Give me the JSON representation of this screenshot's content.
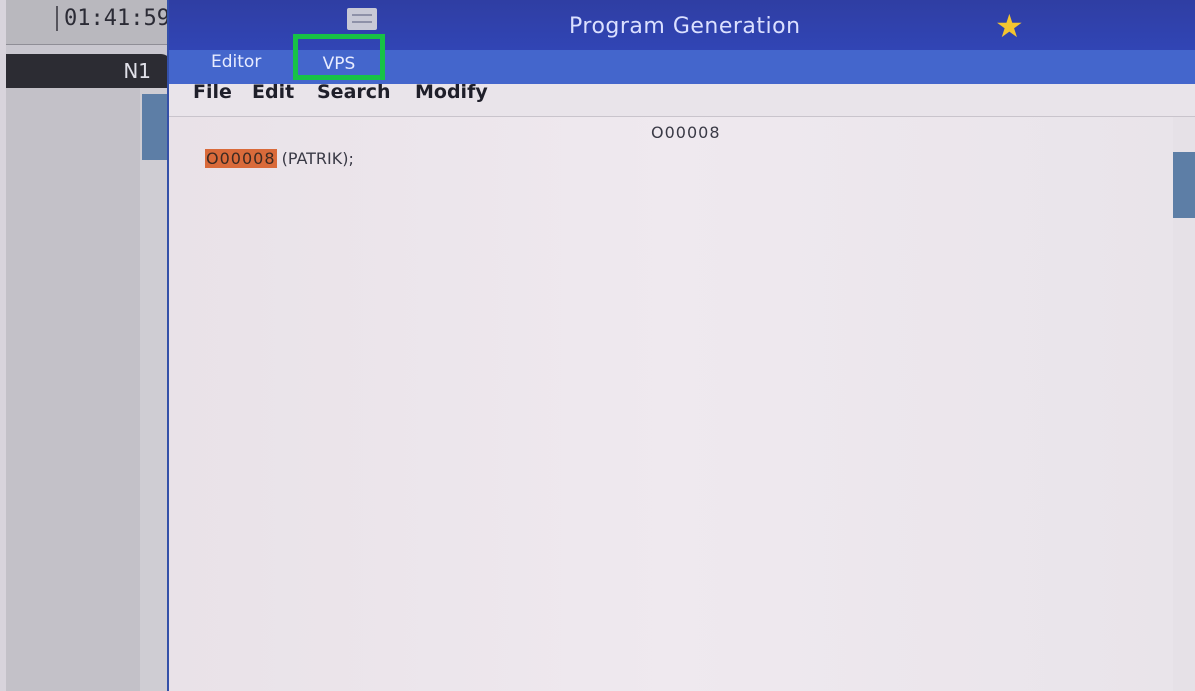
{
  "status": {
    "clock": "01:41:59",
    "line_label": "N1"
  },
  "header": {
    "title": "Program Generation",
    "menu_icon": "hamburger-icon",
    "favorite_icon": "star-icon"
  },
  "tabs": [
    {
      "label": "Editor"
    },
    {
      "label": "VPS",
      "highlighted": true
    }
  ],
  "menubar": {
    "file": "File",
    "edit": "Edit",
    "search": "Search",
    "modify": "Modify"
  },
  "editor": {
    "program_number": "O00008",
    "lines": [
      {
        "highlighted": "O00008",
        "rest": " (PATRIK);"
      }
    ]
  },
  "colors": {
    "header": "#3145b5",
    "tabbar": "#4466cc",
    "highlight_box": "#17c246",
    "cursor": "#d96a3a",
    "star": "#f4c530"
  }
}
